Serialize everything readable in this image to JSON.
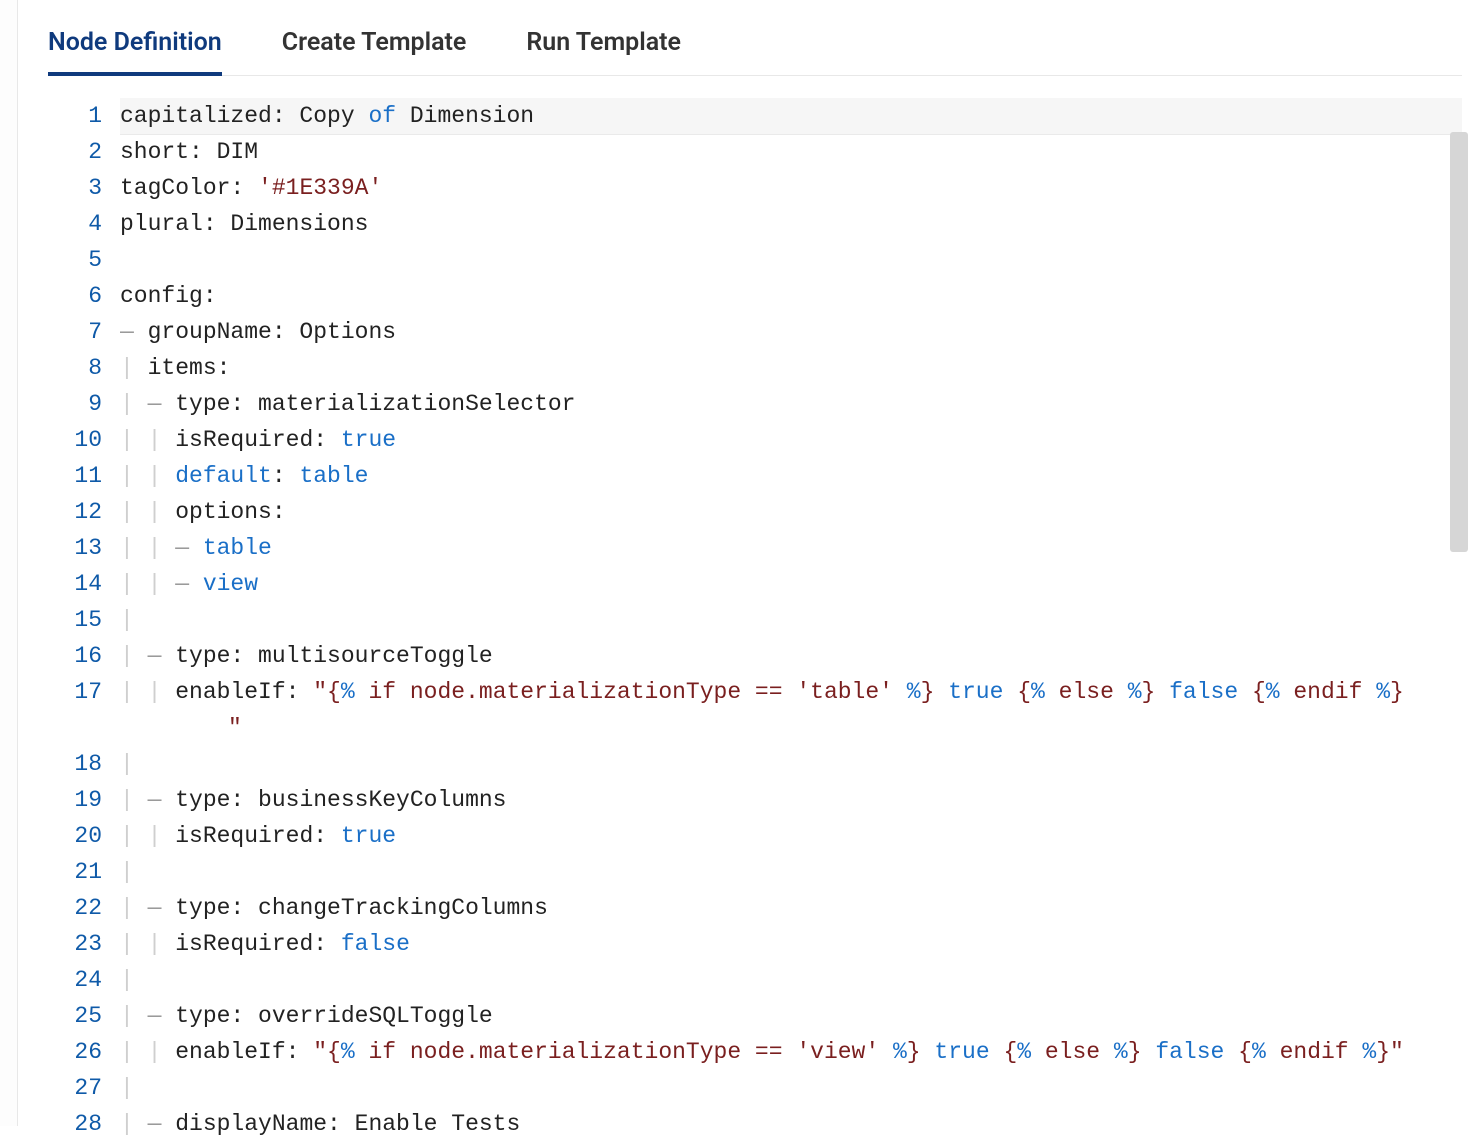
{
  "tabs": [
    {
      "label": "Node Definition",
      "active": true
    },
    {
      "label": "Create Template",
      "active": false
    },
    {
      "label": "Run Template",
      "active": false
    }
  ],
  "editor": {
    "lineNumbers": [
      "1",
      "2",
      "3",
      "4",
      "5",
      "6",
      "7",
      "8",
      "9",
      "10",
      "11",
      "12",
      "13",
      "14",
      "15",
      "16",
      "17",
      "18",
      "19",
      "20",
      "21",
      "22",
      "23",
      "24",
      "25",
      "26",
      "27",
      "28"
    ],
    "highlightedLine": 1,
    "lines": [
      {
        "n": 1,
        "tokens": [
          [
            "pl",
            "capitalized: Copy "
          ],
          [
            "kw",
            "of"
          ],
          [
            "pl",
            " Dimension"
          ]
        ]
      },
      {
        "n": 2,
        "tokens": [
          [
            "pl",
            "short: DIM"
          ]
        ]
      },
      {
        "n": 3,
        "tokens": [
          [
            "pl",
            "tagColor: "
          ],
          [
            "str",
            "'#1E339A'"
          ]
        ]
      },
      {
        "n": 4,
        "tokens": [
          [
            "pl",
            "plural: Dimensions"
          ]
        ]
      },
      {
        "n": 5,
        "tokens": []
      },
      {
        "n": 6,
        "tokens": [
          [
            "pl",
            "config:"
          ]
        ]
      },
      {
        "n": 7,
        "tokens": [
          [
            "dash",
            "— "
          ],
          [
            "pl",
            "groupName: Options"
          ]
        ]
      },
      {
        "n": 8,
        "tokens": [
          [
            "guide",
            "| "
          ],
          [
            "pl",
            "items:"
          ]
        ]
      },
      {
        "n": 9,
        "tokens": [
          [
            "guide",
            "| "
          ],
          [
            "dash",
            "— "
          ],
          [
            "pl",
            "type: materializationSelector"
          ]
        ]
      },
      {
        "n": 10,
        "tokens": [
          [
            "guide",
            "| | "
          ],
          [
            "pl",
            "isRequired: "
          ],
          [
            "kw",
            "true"
          ]
        ]
      },
      {
        "n": 11,
        "tokens": [
          [
            "guide",
            "| | "
          ],
          [
            "kw",
            "default"
          ],
          [
            "pl",
            ": "
          ],
          [
            "kw",
            "table"
          ]
        ]
      },
      {
        "n": 12,
        "tokens": [
          [
            "guide",
            "| | "
          ],
          [
            "pl",
            "options:"
          ]
        ]
      },
      {
        "n": 13,
        "tokens": [
          [
            "guide",
            "| | "
          ],
          [
            "dash",
            "— "
          ],
          [
            "kw",
            "table"
          ]
        ]
      },
      {
        "n": 14,
        "tokens": [
          [
            "guide",
            "| | "
          ],
          [
            "dash",
            "— "
          ],
          [
            "kw",
            "view"
          ]
        ]
      },
      {
        "n": 15,
        "tokens": [
          [
            "guide",
            "| "
          ]
        ]
      },
      {
        "n": 16,
        "tokens": [
          [
            "guide",
            "| "
          ],
          [
            "dash",
            "— "
          ],
          [
            "pl",
            "type: multisourceToggle"
          ]
        ]
      },
      {
        "n": 17,
        "tokens": [
          [
            "guide",
            "| | "
          ],
          [
            "pl",
            "enableIf: "
          ],
          [
            "str",
            "\"{"
          ],
          [
            "kw",
            "%"
          ],
          [
            "str",
            " if node.materializationType == 'table' "
          ],
          [
            "kw",
            "%"
          ],
          [
            "str",
            "}"
          ],
          [
            "pl",
            " "
          ],
          [
            "kw",
            "true"
          ],
          [
            "pl",
            " "
          ],
          [
            "str",
            "{"
          ],
          [
            "kw",
            "%"
          ],
          [
            "str",
            " else "
          ],
          [
            "kw",
            "%"
          ],
          [
            "str",
            "}"
          ],
          [
            "pl",
            " "
          ],
          [
            "kw",
            "false"
          ],
          [
            "pl",
            " "
          ],
          [
            "str",
            "{"
          ],
          [
            "kw",
            "%"
          ],
          [
            "str",
            " endif "
          ],
          [
            "kw",
            "%"
          ],
          [
            "str",
            "}"
          ]
        ]
      },
      {
        "n": "17b",
        "tokens": [
          [
            "str",
            "\""
          ]
        ],
        "cont": true
      },
      {
        "n": 18,
        "tokens": [
          [
            "guide",
            "| "
          ]
        ]
      },
      {
        "n": 19,
        "tokens": [
          [
            "guide",
            "| "
          ],
          [
            "dash",
            "— "
          ],
          [
            "pl",
            "type: businessKeyColumns"
          ]
        ]
      },
      {
        "n": 20,
        "tokens": [
          [
            "guide",
            "| | "
          ],
          [
            "pl",
            "isRequired: "
          ],
          [
            "kw",
            "true"
          ]
        ]
      },
      {
        "n": 21,
        "tokens": [
          [
            "guide",
            "| "
          ]
        ]
      },
      {
        "n": 22,
        "tokens": [
          [
            "guide",
            "| "
          ],
          [
            "dash",
            "— "
          ],
          [
            "pl",
            "type: changeTrackingColumns"
          ]
        ]
      },
      {
        "n": 23,
        "tokens": [
          [
            "guide",
            "| | "
          ],
          [
            "pl",
            "isRequired: "
          ],
          [
            "kw",
            "false"
          ]
        ]
      },
      {
        "n": 24,
        "tokens": [
          [
            "guide",
            "| "
          ]
        ]
      },
      {
        "n": 25,
        "tokens": [
          [
            "guide",
            "| "
          ],
          [
            "dash",
            "— "
          ],
          [
            "pl",
            "type: overrideSQLToggle"
          ]
        ]
      },
      {
        "n": 26,
        "tokens": [
          [
            "guide",
            "| | "
          ],
          [
            "pl",
            "enableIf: "
          ],
          [
            "str",
            "\"{"
          ],
          [
            "kw",
            "%"
          ],
          [
            "str",
            " if node.materializationType == 'view' "
          ],
          [
            "kw",
            "%"
          ],
          [
            "str",
            "}"
          ],
          [
            "pl",
            " "
          ],
          [
            "kw",
            "true"
          ],
          [
            "pl",
            " "
          ],
          [
            "str",
            "{"
          ],
          [
            "kw",
            "%"
          ],
          [
            "str",
            " else "
          ],
          [
            "kw",
            "%"
          ],
          [
            "str",
            "}"
          ],
          [
            "pl",
            " "
          ],
          [
            "kw",
            "false"
          ],
          [
            "pl",
            " "
          ],
          [
            "str",
            "{"
          ],
          [
            "kw",
            "%"
          ],
          [
            "str",
            " endif "
          ],
          [
            "kw",
            "%"
          ],
          [
            "str",
            "}\""
          ]
        ]
      },
      {
        "n": 27,
        "tokens": [
          [
            "guide",
            "| "
          ]
        ]
      },
      {
        "n": 28,
        "tokens": [
          [
            "guide",
            "| "
          ],
          [
            "dash",
            "— "
          ],
          [
            "pl",
            "displayName: Enable Tests"
          ]
        ]
      }
    ]
  }
}
